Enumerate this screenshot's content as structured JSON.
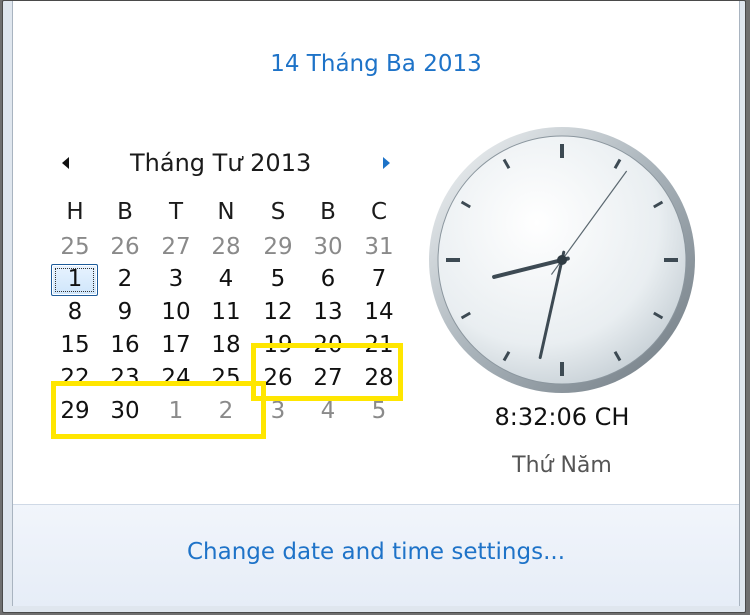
{
  "header": {
    "current_date": "14 Tháng Ba 2013"
  },
  "calendar": {
    "month_title": "Tháng Tư 2013",
    "weekdays": [
      "H",
      "B",
      "T",
      "N",
      "S",
      "B",
      "C"
    ],
    "rows": [
      [
        {
          "d": "25",
          "o": true
        },
        {
          "d": "26",
          "o": true
        },
        {
          "d": "27",
          "o": true
        },
        {
          "d": "28",
          "o": true
        },
        {
          "d": "29",
          "o": true
        },
        {
          "d": "30",
          "o": true
        },
        {
          "d": "31",
          "o": true
        }
      ],
      [
        {
          "d": "1",
          "o": false
        },
        {
          "d": "2",
          "o": false
        },
        {
          "d": "3",
          "o": false
        },
        {
          "d": "4",
          "o": false
        },
        {
          "d": "5",
          "o": false
        },
        {
          "d": "6",
          "o": false
        },
        {
          "d": "7",
          "o": false
        }
      ],
      [
        {
          "d": "8",
          "o": false
        },
        {
          "d": "9",
          "o": false
        },
        {
          "d": "10",
          "o": false
        },
        {
          "d": "11",
          "o": false
        },
        {
          "d": "12",
          "o": false
        },
        {
          "d": "13",
          "o": false
        },
        {
          "d": "14",
          "o": false
        }
      ],
      [
        {
          "d": "15",
          "o": false
        },
        {
          "d": "16",
          "o": false
        },
        {
          "d": "17",
          "o": false
        },
        {
          "d": "18",
          "o": false
        },
        {
          "d": "19",
          "o": false
        },
        {
          "d": "20",
          "o": false
        },
        {
          "d": "21",
          "o": false
        }
      ],
      [
        {
          "d": "22",
          "o": false
        },
        {
          "d": "23",
          "o": false
        },
        {
          "d": "24",
          "o": false
        },
        {
          "d": "25",
          "o": false
        },
        {
          "d": "26",
          "o": false
        },
        {
          "d": "27",
          "o": false
        },
        {
          "d": "28",
          "o": false
        }
      ],
      [
        {
          "d": "29",
          "o": false
        },
        {
          "d": "30",
          "o": false
        },
        {
          "d": "1",
          "o": true
        },
        {
          "d": "2",
          "o": true
        },
        {
          "d": "3",
          "o": true
        },
        {
          "d": "4",
          "o": true
        },
        {
          "d": "5",
          "o": true
        }
      ]
    ],
    "selected_day": "1"
  },
  "clock": {
    "time": "8:32:06 CH",
    "weekday": "Thứ Năm",
    "hours": 8,
    "minutes": 32,
    "seconds": 6
  },
  "footer": {
    "settings_link": "Change date and time settings..."
  },
  "colors": {
    "link": "#1e73c8",
    "highlight": "#ffe600"
  }
}
